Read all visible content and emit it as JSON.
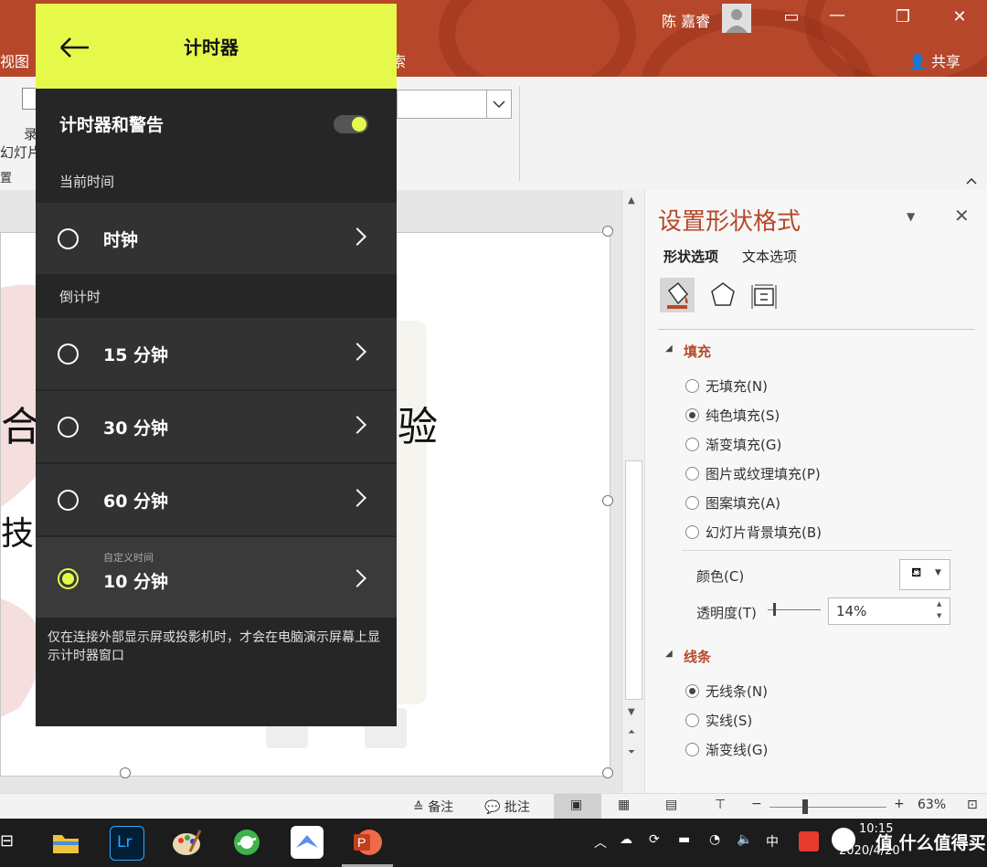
{
  "window": {
    "user_name": "陈 嘉睿",
    "tab_view": "视图",
    "tab_search_fragment": "索",
    "share_label": "共享"
  },
  "ribbon": {
    "fragment_1": "录",
    "fragment_2": "幻灯片",
    "fragment_3": "置"
  },
  "slide": {
    "text_fragment_1": "合",
    "text_fragment_2": "验",
    "text_fragment_3": "技S"
  },
  "timer_panel": {
    "title": "计时器",
    "toggle_label": "计时器和警告",
    "toggle_on": true,
    "section_current": "当前时间",
    "clock_label": "时钟",
    "section_countdown": "倒计时",
    "options": [
      {
        "label": "15 分钟",
        "selected": false
      },
      {
        "label": "30 分钟",
        "selected": false
      },
      {
        "label": "60 分钟",
        "selected": false
      }
    ],
    "custom_caption": "自定义时间",
    "custom_label": "10 分钟",
    "footer_note": "仅在连接外部显示屏或投影机时，才会在电脑演示屏幕上显示计时器窗口",
    "accent_color": "#e6f94b"
  },
  "format_pane": {
    "title": "设置形状格式",
    "tabs": [
      "形状选项",
      "文本选项"
    ],
    "fill_section": "填充",
    "fill_options": [
      {
        "label": "无填充(N)",
        "selected": false
      },
      {
        "label": "纯色填充(S)",
        "selected": true
      },
      {
        "label": "渐变填充(G)",
        "selected": false
      },
      {
        "label": "图片或纹理填充(P)",
        "selected": false
      },
      {
        "label": "图案填充(A)",
        "selected": false
      },
      {
        "label": "幻灯片背景填充(B)",
        "selected": false
      }
    ],
    "color_label": "颜色(C)",
    "transparency_label": "透明度(T)",
    "transparency_value": "14%",
    "line_section": "线条",
    "line_options": [
      {
        "label": "无线条(N)",
        "selected": true
      },
      {
        "label": "实线(S)",
        "selected": false
      },
      {
        "label": "渐变线(G)",
        "selected": false
      }
    ],
    "accent_color": "#b7472a"
  },
  "statusbar": {
    "notes_label": "备注",
    "comments_label": "批注",
    "zoom_label": "63%",
    "minus": "−",
    "plus": "+"
  },
  "taskbar": {
    "lr_label": "Lr",
    "ime_label": "中",
    "time": "10:15",
    "date": "2020/4/20",
    "watermark": "值 什么值得买"
  }
}
